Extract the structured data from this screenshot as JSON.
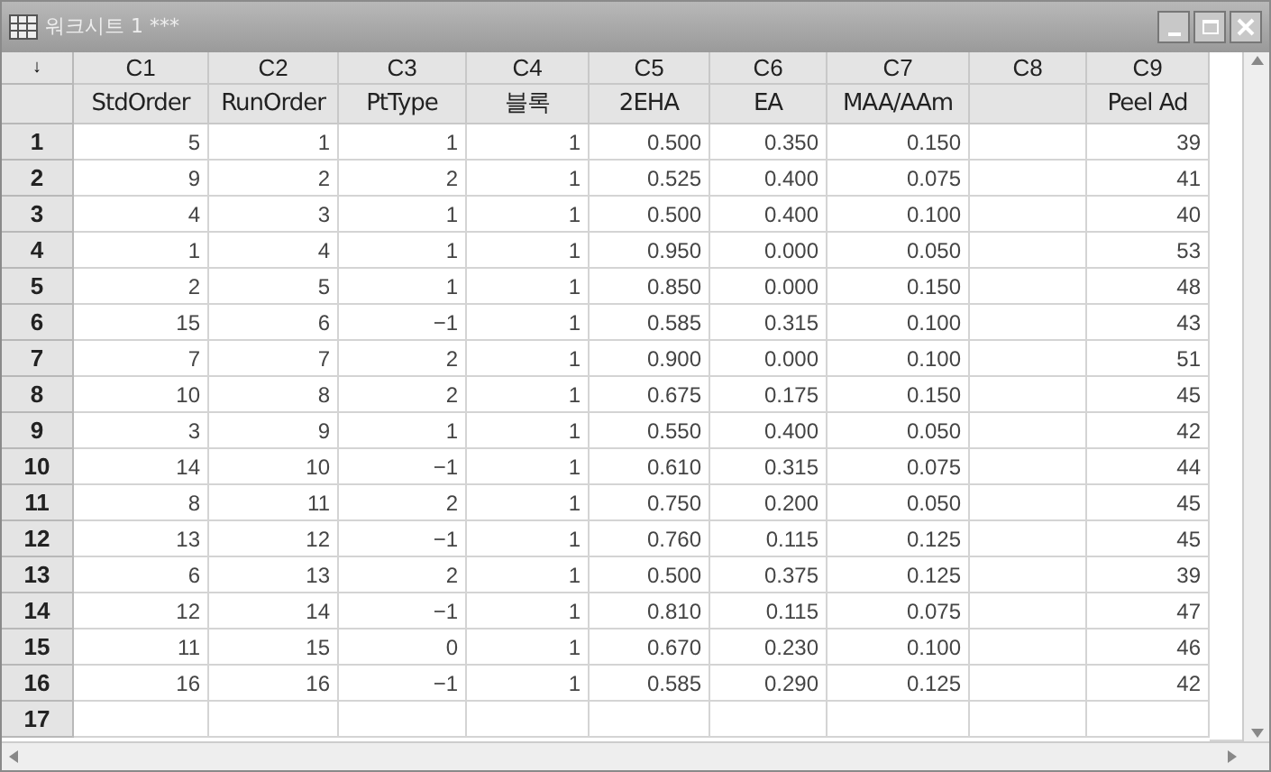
{
  "window": {
    "title": "워크시트 1 ***"
  },
  "table": {
    "corner": "↓",
    "columns": [
      {
        "id": "C1",
        "name": "StdOrder"
      },
      {
        "id": "C2",
        "name": "RunOrder"
      },
      {
        "id": "C3",
        "name": "PtType"
      },
      {
        "id": "C4",
        "name": "블록"
      },
      {
        "id": "C5",
        "name": "2EHA"
      },
      {
        "id": "C6",
        "name": "EA"
      },
      {
        "id": "C7",
        "name": "MAA/AAm"
      },
      {
        "id": "C8"
      },
      {
        "id": "C9",
        "name": "Peel Ad"
      }
    ],
    "rows": [
      {
        "number": "1",
        "cells": [
          "5",
          "1",
          "1",
          "1",
          "0.500",
          "0.350",
          "0.150",
          null,
          "39"
        ]
      },
      {
        "number": "2",
        "cells": [
          "9",
          "2",
          "2",
          "1",
          "0.525",
          "0.400",
          "0.075",
          null,
          "41"
        ]
      },
      {
        "number": "3",
        "cells": [
          "4",
          "3",
          "1",
          "1",
          "0.500",
          "0.400",
          "0.100",
          null,
          "40"
        ]
      },
      {
        "number": "4",
        "cells": [
          "1",
          "4",
          "1",
          "1",
          "0.950",
          "0.000",
          "0.050",
          null,
          "53"
        ]
      },
      {
        "number": "5",
        "cells": [
          "2",
          "5",
          "1",
          "1",
          "0.850",
          "0.000",
          "0.150",
          null,
          "48"
        ]
      },
      {
        "number": "6",
        "cells": [
          "15",
          "6",
          "−1",
          "1",
          "0.585",
          "0.315",
          "0.100",
          null,
          "43"
        ]
      },
      {
        "number": "7",
        "cells": [
          "7",
          "7",
          "2",
          "1",
          "0.900",
          "0.000",
          "0.100",
          null,
          "51"
        ]
      },
      {
        "number": "8",
        "cells": [
          "10",
          "8",
          "2",
          "1",
          "0.675",
          "0.175",
          "0.150",
          null,
          "45"
        ]
      },
      {
        "number": "9",
        "cells": [
          "3",
          "9",
          "1",
          "1",
          "0.550",
          "0.400",
          "0.050",
          null,
          "42"
        ]
      },
      {
        "number": "10",
        "cells": [
          "14",
          "10",
          "−1",
          "1",
          "0.610",
          "0.315",
          "0.075",
          null,
          "44"
        ]
      },
      {
        "number": "11",
        "cells": [
          "8",
          "11",
          "2",
          "1",
          "0.750",
          "0.200",
          "0.050",
          null,
          "45"
        ]
      },
      {
        "number": "12",
        "cells": [
          "13",
          "12",
          "−1",
          "1",
          "0.760",
          "0.115",
          "0.125",
          null,
          "45"
        ]
      },
      {
        "number": "13",
        "cells": [
          "6",
          "13",
          "2",
          "1",
          "0.500",
          "0.375",
          "0.125",
          null,
          "39"
        ]
      },
      {
        "number": "14",
        "cells": [
          "12",
          "14",
          "−1",
          "1",
          "0.810",
          "0.115",
          "0.075",
          null,
          "47"
        ]
      },
      {
        "number": "15",
        "cells": [
          "11",
          "15",
          "0",
          "1",
          "0.670",
          "0.230",
          "0.100",
          null,
          "46"
        ]
      },
      {
        "number": "16",
        "cells": [
          "16",
          "16",
          "−1",
          "1",
          "0.585",
          "0.290",
          "0.125",
          null,
          "42"
        ]
      },
      {
        "number": "17",
        "cells": [
          null,
          null,
          null,
          null,
          null,
          null,
          null,
          null,
          null
        ]
      }
    ]
  }
}
